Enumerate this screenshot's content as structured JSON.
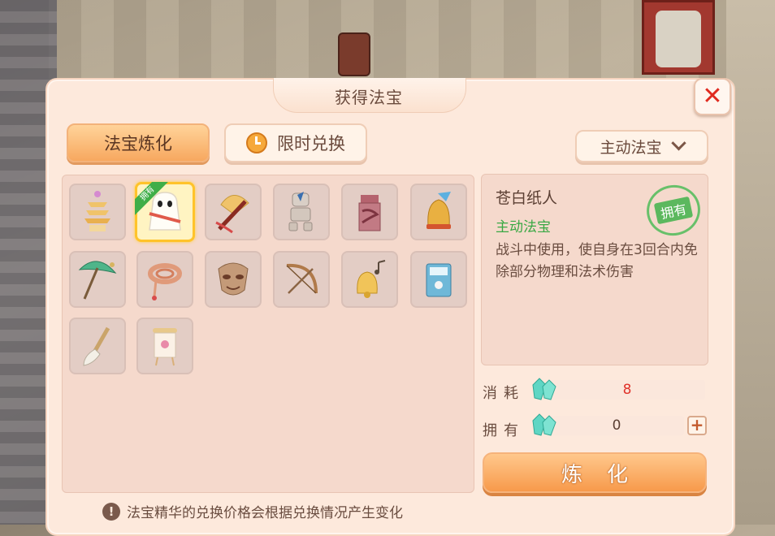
{
  "window": {
    "title": "获得法宝",
    "close_symbol": "✕"
  },
  "tabs": [
    {
      "label": "法宝炼化",
      "active": true
    },
    {
      "label": "限时兑换",
      "active": false,
      "icon": "stopwatch-icon"
    }
  ],
  "filter_dropdown": {
    "selected": "主动法宝"
  },
  "items": [
    {
      "name": "pagoda-icon",
      "selected": false
    },
    {
      "name": "paper-figure-icon",
      "selected": true,
      "owned_label": "拥有"
    },
    {
      "name": "fan-sword-icon",
      "selected": false
    },
    {
      "name": "puppet-icon",
      "selected": false
    },
    {
      "name": "box-icon",
      "selected": false
    },
    {
      "name": "bell-icon",
      "selected": false
    },
    {
      "name": "umbrella-icon",
      "selected": false
    },
    {
      "name": "rope-icon",
      "selected": false
    },
    {
      "name": "mask-icon",
      "selected": false
    },
    {
      "name": "bow-icon",
      "selected": false
    },
    {
      "name": "golden-bell-icon",
      "selected": false
    },
    {
      "name": "book-icon",
      "selected": false
    },
    {
      "name": "brush-icon",
      "selected": false
    },
    {
      "name": "scroll-icon",
      "selected": false
    }
  ],
  "detail": {
    "name": "苍白纸人",
    "type": "主动法宝",
    "description": "战斗中使用，使自身在3回合内免除部分物理和法术伤害",
    "stamp": "拥有"
  },
  "cost": {
    "label": "消耗",
    "value": "8",
    "value_color": "#e0322a"
  },
  "owned": {
    "label": "拥有",
    "value": "0",
    "plus_symbol": "+"
  },
  "refine_button": {
    "label": "炼化"
  },
  "notice": {
    "icon_symbol": "!",
    "text": "法宝精华的兑换价格会根据兑换情况产生变化"
  },
  "colors": {
    "accent_orange": "#f79a4b",
    "green_type": "#39a844",
    "panel_bg": "#fde9dc"
  }
}
